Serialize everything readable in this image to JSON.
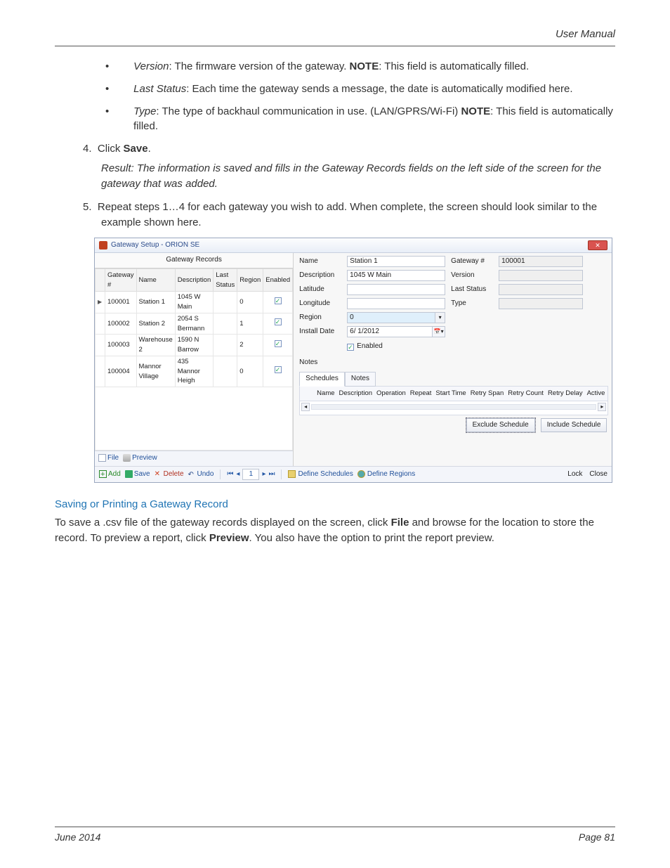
{
  "header": {
    "right": "User Manual"
  },
  "bullets": {
    "version_name": "Version",
    "version_text": ": The firmware version of the gateway. ",
    "version_note_label": "NOTE",
    "version_note": ": This field is automatically filled.",
    "laststatus_name": "Last Status",
    "laststatus_text": ": Each time the gateway sends a message, the date is automatically modified here.",
    "type_name": "Type",
    "type_text": ": The type of backhaul communication in use. (LAN/GPRS/Wi-Fi) ",
    "type_note_label": "NOTE",
    "type_note": ": This field is automatically filled."
  },
  "step4": {
    "num": "4.",
    "lead": "Click ",
    "bold": "Save",
    "tail": ".",
    "result": "Result: The information is saved and fills in the Gateway Records fields on the left side of the screen for the gateway that was added."
  },
  "step5": {
    "num": "5.",
    "text": "Repeat steps 1…4 for each gateway you wish to add. When complete, the screen should look similar to the example shown here."
  },
  "screenshot": {
    "title": "Gateway Setup - ORION SE",
    "left_header": "Gateway Records",
    "cols": {
      "gw": "Gateway #",
      "name": "Name",
      "desc": "Description",
      "ls": "Last Status",
      "region": "Region",
      "enabled": "Enabled"
    },
    "rows": [
      {
        "sel": true,
        "gw": "100001",
        "name": "Station 1",
        "desc": "1045 W Main",
        "region": "0",
        "enabled": true
      },
      {
        "sel": false,
        "gw": "100002",
        "name": "Station 2",
        "desc": "2054 S Bermann",
        "region": "1",
        "enabled": true
      },
      {
        "sel": false,
        "gw": "100003",
        "name": "Warehouse 2",
        "desc": "1590 N Barrow",
        "region": "2",
        "enabled": true
      },
      {
        "sel": false,
        "gw": "100004",
        "name": "Mannor Village",
        "desc": "435 Mannor Heigh",
        "region": "0",
        "enabled": true
      }
    ],
    "lp_toolbar": {
      "file": "File",
      "preview": "Preview"
    },
    "form": {
      "name_lbl": "Name",
      "name_val": "Station 1",
      "desc_lbl": "Description",
      "desc_val": "1045 W Main",
      "lat_lbl": "Latitude",
      "lat_val": "",
      "lon_lbl": "Longitude",
      "lon_val": "",
      "region_lbl": "Region",
      "region_val": "0",
      "install_lbl": "Install Date",
      "install_val": "6/ 1/2012",
      "enabled_lbl": "Enabled",
      "notes_lbl": "Notes",
      "gw_lbl": "Gateway #",
      "gw_val": "100001",
      "ver_lbl": "Version",
      "ver_val": "",
      "ls_lbl": "Last Status",
      "ls_val": "",
      "type_lbl": "Type",
      "type_val": ""
    },
    "tabs": {
      "schedules": "Schedules",
      "notes": "Notes"
    },
    "sched_cols": {
      "name": "Name",
      "desc": "Description",
      "op": "Operation",
      "repeat": "Repeat",
      "start": "Start Time",
      "span": "Retry Span",
      "count": "Retry Count",
      "delay": "Retry Delay",
      "active": "Active"
    },
    "sched_btns": {
      "exclude": "Exclude Schedule",
      "include": "Include Schedule"
    },
    "bottombar": {
      "add": "Add",
      "save": "Save",
      "delete": "Delete",
      "undo": "Undo",
      "page": "1",
      "defsched": "Define Schedules",
      "defreg": "Define Regions",
      "lock": "Lock",
      "close": "Close"
    }
  },
  "section_title": "Saving or Printing a Gateway Record",
  "section_body": {
    "p1a": "To save a .csv file of the gateway records displayed on the screen, click ",
    "p1b": "File",
    "p1c": " and browse for the location to store the record. To preview a report, click ",
    "p1d": "Preview",
    "p1e": ". You also have the option to print the report preview."
  },
  "footer": {
    "left": "June 2014",
    "right": "Page 81"
  }
}
